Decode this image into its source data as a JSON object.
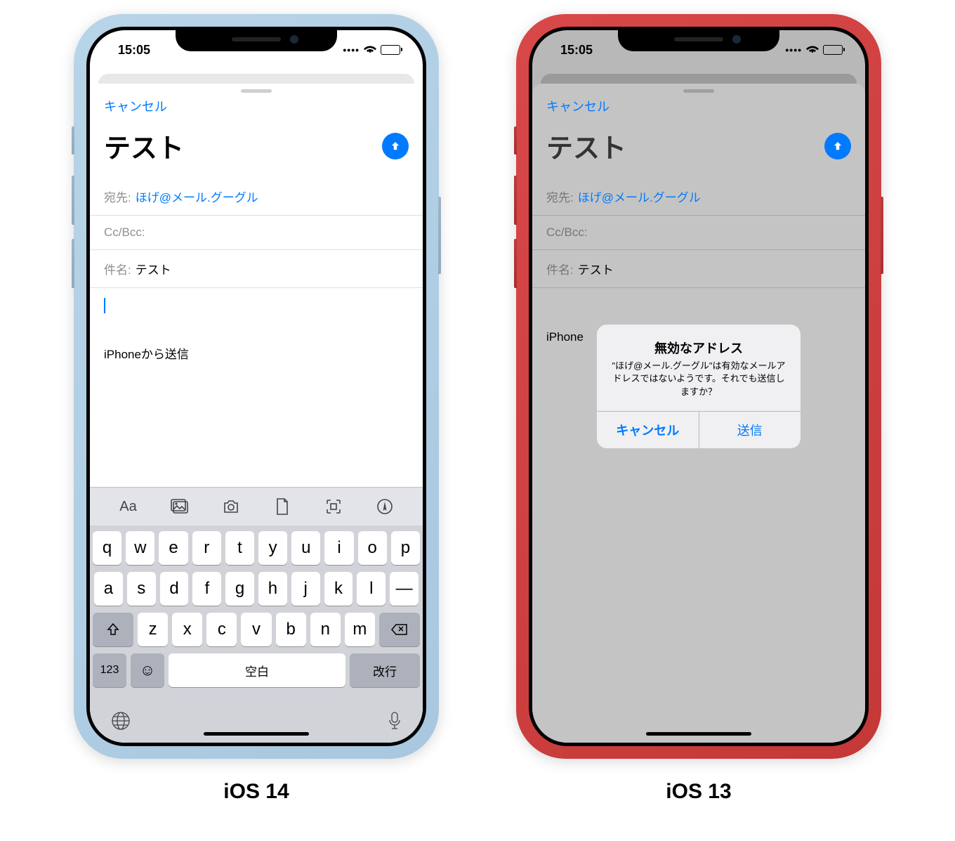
{
  "labels": {
    "ios14": "iOS 14",
    "ios13": "iOS 13"
  },
  "statusBar": {
    "time": "15:05"
  },
  "compose": {
    "cancel": "キャンセル",
    "title": "テスト",
    "toLabel": "宛先:",
    "toValue": "ほげ@メール.グーグル",
    "ccBccLabel": "Cc/Bcc:",
    "subjectLabel": "件名:",
    "subjectValue": "テスト",
    "signature": "iPhoneから送信",
    "signaturePartial": "iPhone"
  },
  "keyboard": {
    "toolbar": {
      "aa": "Aa"
    },
    "row1": [
      "q",
      "w",
      "e",
      "r",
      "t",
      "y",
      "u",
      "i",
      "o",
      "p"
    ],
    "row2": [
      "a",
      "s",
      "d",
      "f",
      "g",
      "h",
      "j",
      "k",
      "l",
      "—"
    ],
    "row3": [
      "z",
      "x",
      "c",
      "v",
      "b",
      "n",
      "m"
    ],
    "numKey": "123",
    "spaceLabel": "空白",
    "returnLabel": "改行"
  },
  "alert": {
    "title": "無効なアドレス",
    "message": "\"ほげ@メール.グーグル\"は有効なメールアドレスではないようです。それでも送信しますか？",
    "cancel": "キャンセル",
    "send": "送信"
  }
}
